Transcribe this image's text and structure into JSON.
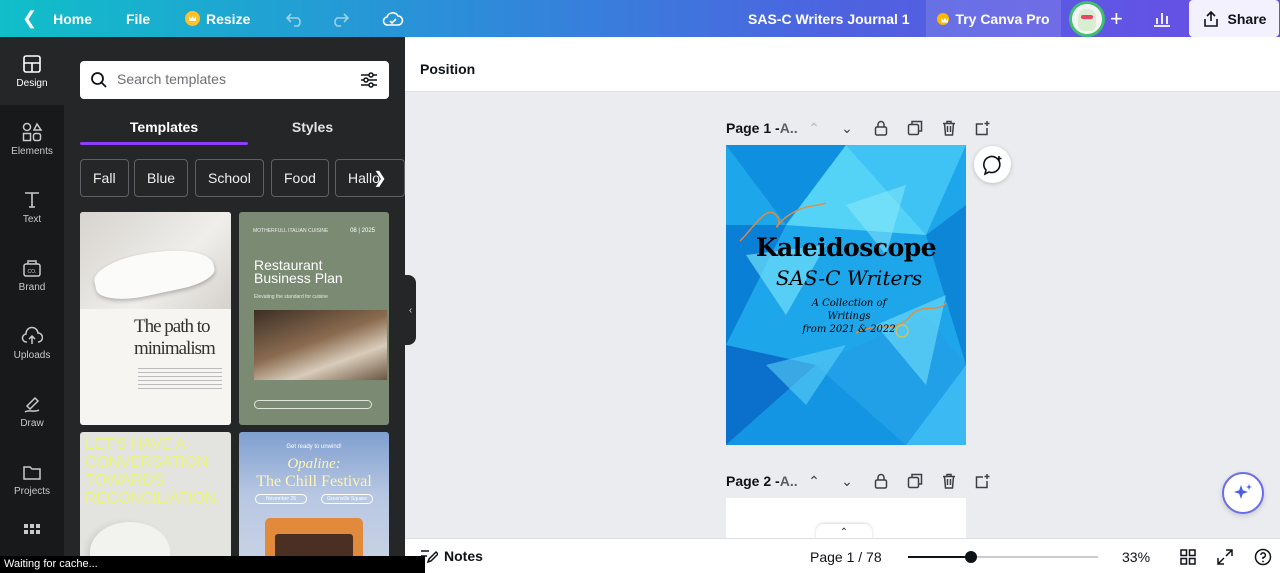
{
  "topbar": {
    "home_label": "Home",
    "file_label": "File",
    "resize_label": "Resize",
    "doc_title": "SAS-C Writers Journal 1",
    "try_pro_label": "Try Canva Pro",
    "share_label": "Share",
    "gradient_colors": [
      "#10bfc9",
      "#4d63e0",
      "#6b4de6"
    ]
  },
  "rail": {
    "items": [
      {
        "label": "Design",
        "icon": "design-icon"
      },
      {
        "label": "Elements",
        "icon": "elements-icon"
      },
      {
        "label": "Text",
        "icon": "text-icon"
      },
      {
        "label": "Brand",
        "icon": "brand-icon"
      },
      {
        "label": "Uploads",
        "icon": "uploads-icon"
      },
      {
        "label": "Draw",
        "icon": "draw-icon"
      },
      {
        "label": "Projects",
        "icon": "projects-icon"
      },
      {
        "label": "",
        "icon": "apps-grid-icon"
      }
    ]
  },
  "panel": {
    "search_placeholder": "Search templates",
    "tabs": [
      {
        "label": "Templates"
      },
      {
        "label": "Styles"
      }
    ],
    "chips": [
      {
        "label": "Fall"
      },
      {
        "label": "Blue"
      },
      {
        "label": "School"
      },
      {
        "label": "Food"
      },
      {
        "label": "Hallo"
      }
    ],
    "templates": {
      "t1": {
        "heading": "The path to minimalism"
      },
      "t2": {
        "top": "MOTHERFULL ITALIAN CUISINE",
        "date": "08 | 2025",
        "title": "Restaurant Business Plan",
        "sub": "Elevating the standard for cuisine"
      },
      "t3": {
        "heading": "LET'S HAVE A CONVERSATION TOWARDS RECONCILIATION."
      },
      "t4": {
        "small": "Get ready to unwind!",
        "title1": "Opaline:",
        "title2": "The Chill Festival",
        "pill1": "November 26",
        "pill2": "Greenville Square"
      }
    }
  },
  "canvas": {
    "position_label": "Position",
    "page1_label": "Page 1 - ",
    "page1_suffix": "A..",
    "page2_label": "Page 2 - ",
    "page2_suffix": "A..",
    "cover": {
      "title": "Kaleidoscope",
      "subtitle": "SAS-C Writers",
      "note_line1": "A Collection of Writings",
      "note_line2": "from 2021 & 2022"
    }
  },
  "bottombar": {
    "notes_label": "Notes",
    "page_count": "Page 1 / 78",
    "zoom_label": "33%",
    "zoom_fraction": 0.33
  },
  "status_text": "Waiting for cache..."
}
